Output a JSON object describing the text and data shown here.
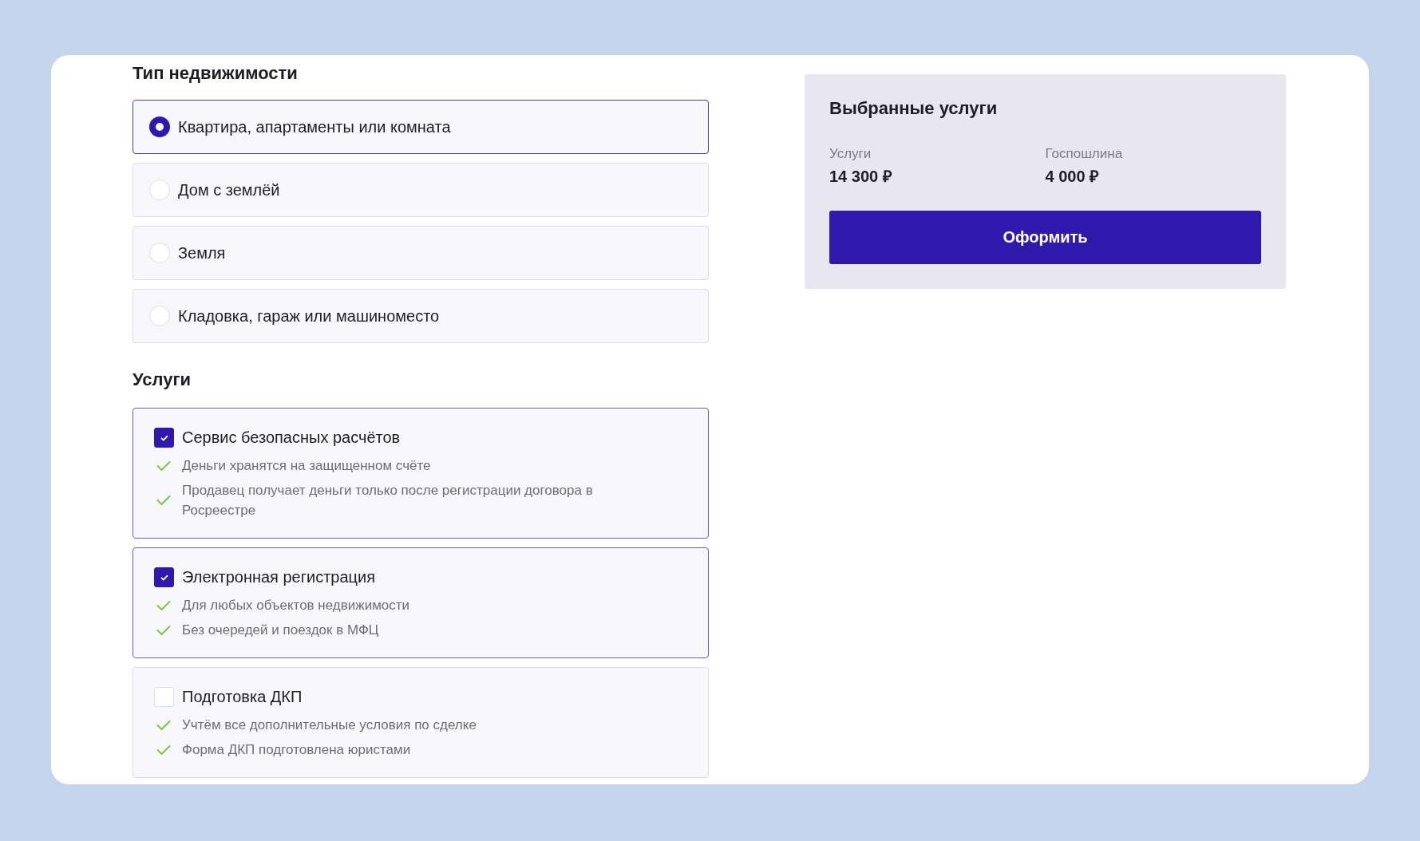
{
  "property_type": {
    "title": "Тип недвижимости",
    "options": [
      {
        "label": "Квартира, апартаменты или комната",
        "selected": true
      },
      {
        "label": "Дом с землёй",
        "selected": false
      },
      {
        "label": "Земля",
        "selected": false
      },
      {
        "label": "Кладовка, гараж или машиноместо",
        "selected": false
      }
    ]
  },
  "services": {
    "title": "Услуги",
    "items": [
      {
        "label": "Сервис безопасных расчётов",
        "checked": true,
        "features": [
          "Деньги хранятся на защищенном счёте",
          "Продавец получает деньги только после регистрации договора в Росреестре"
        ]
      },
      {
        "label": "Электронная регистрация",
        "checked": true,
        "features": [
          "Для любых объектов недвижимости",
          "Без очередей и поездок в МФЦ"
        ]
      },
      {
        "label": "Подготовка ДКП",
        "checked": false,
        "features": [
          "Учтём все дополнительные условия по сделке",
          "Форма ДКП подготовлена юристами"
        ]
      }
    ]
  },
  "summary": {
    "title": "Выбранные услуги",
    "fields": [
      {
        "label": "Услуги",
        "value": "14 300 ₽"
      },
      {
        "label": "Госпошлина",
        "value": "4 000 ₽"
      }
    ],
    "button": "Оформить"
  }
}
